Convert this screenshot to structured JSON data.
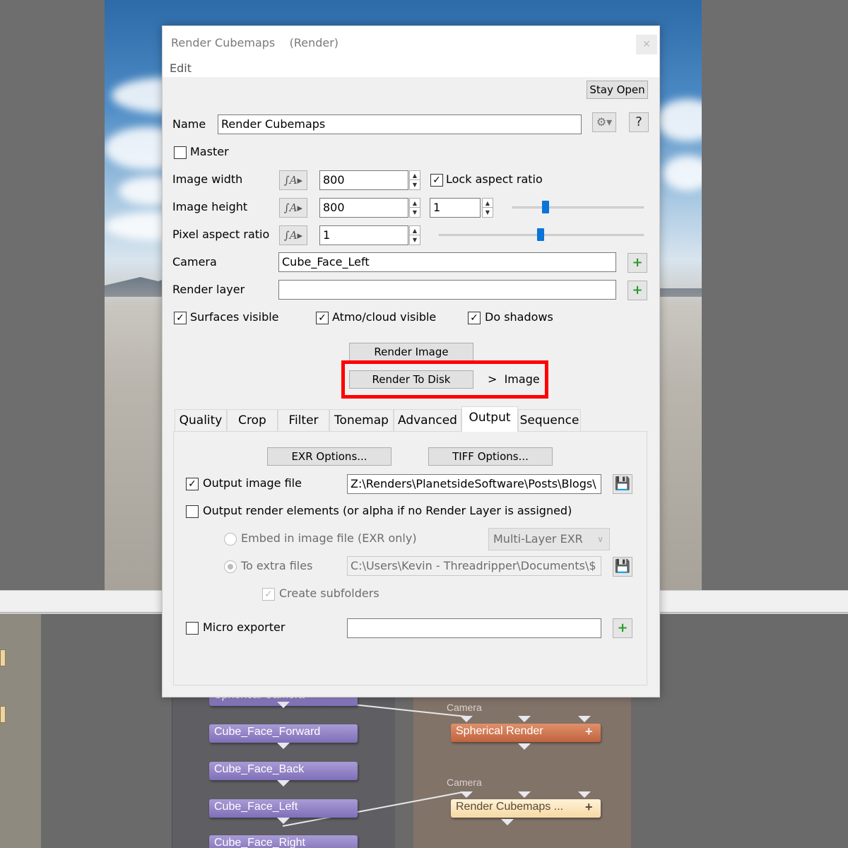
{
  "dialog": {
    "title": "Render Cubemaps    (Render)",
    "close_icon": "close-icon",
    "menu_edit": "Edit",
    "stay_open": "Stay Open",
    "name_label": "Name",
    "name_value": "Render Cubemaps",
    "help": "?",
    "master_label": "Master",
    "master_checked": false,
    "image_width_label": "Image width",
    "image_width_value": "800",
    "lock_aspect_label": "Lock aspect ratio",
    "lock_aspect_checked": true,
    "image_height_label": "Image height",
    "image_height_value": "800",
    "aspect_value": "1",
    "pixel_aspect_label": "Pixel aspect ratio",
    "pixel_aspect_value": "1",
    "camera_label": "Camera",
    "camera_value": "Cube_Face_Left",
    "render_layer_label": "Render layer",
    "render_layer_value": "",
    "surfaces_visible_label": "Surfaces visible",
    "atmo_visible_label": "Atmo/cloud visible",
    "do_shadows_label": "Do shadows",
    "render_image_button": "Render Image",
    "render_to_disk_button": "Render To Disk",
    "render_to_disk_target": ">  Image",
    "tabs": [
      "Quality",
      "Crop",
      "Filter",
      "Tonemap",
      "Advanced",
      "Output",
      "Sequence"
    ],
    "active_tab": "Output",
    "output": {
      "exr_options": "EXR Options...",
      "tiff_options": "TIFF Options...",
      "output_image_file_label": "Output image file",
      "output_image_file_checked": true,
      "output_image_file_path": "Z:\\Renders\\PlanetsideSoftware\\Posts\\Blogs\\",
      "output_render_elements_label": "Output render elements (or alpha if no Render Layer is assigned)",
      "embed_label": "Embed in image file (EXR only)",
      "embed_format": "Multi-Layer EXR",
      "extra_files_label": "To extra files",
      "extra_files_path": "C:\\Users\\Kevin - Threadripper\\Documents\\$",
      "create_subfolders_label": "Create subfolders",
      "micro_exporter_label": "Micro exporter",
      "micro_exporter_value": ""
    }
  },
  "network": {
    "nodes_left": [
      "Spherical Camera",
      "Cube_Face_Forward",
      "Cube_Face_Back",
      "Cube_Face_Left",
      "Cube_Face_Right"
    ],
    "port_label_1": "Camera",
    "port_label_2": "Camera",
    "node_spherical_render": "Spherical Render",
    "node_render_cubemaps": "Render Cubemaps ..."
  },
  "colors": {
    "highlight": "#ff0000",
    "slider_thumb": "#0a74d9",
    "camera_node": "#8f80c6",
    "render_node": "#d27950",
    "selected_node": "#fbe6bd"
  }
}
